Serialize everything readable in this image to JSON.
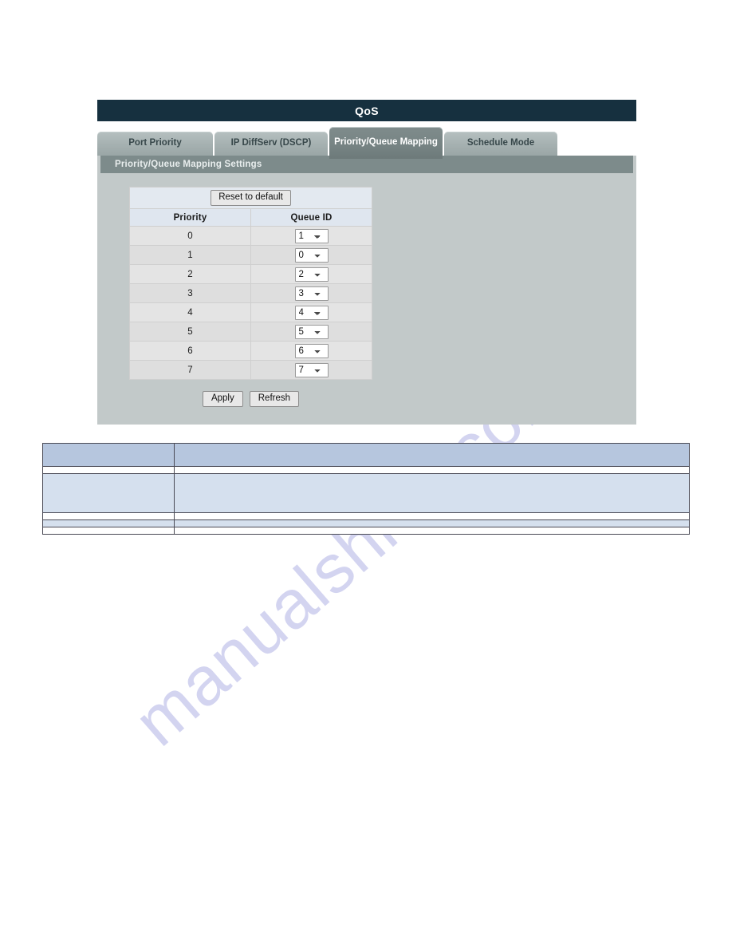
{
  "panel": {
    "title": "QoS",
    "tabs": [
      {
        "label": "Port Priority",
        "active": false
      },
      {
        "label": "IP DiffServ (DSCP)",
        "active": false
      },
      {
        "label": "Priority/Queue Mapping",
        "active": true
      },
      {
        "label": "Schedule Mode",
        "active": false
      }
    ],
    "section_header": "Priority/Queue Mapping Settings",
    "reset_button": "Reset to default",
    "table": {
      "headers": [
        "Priority",
        "Queue ID"
      ],
      "rows": [
        {
          "priority": "0",
          "queue_id": "1"
        },
        {
          "priority": "1",
          "queue_id": "0"
        },
        {
          "priority": "2",
          "queue_id": "2"
        },
        {
          "priority": "3",
          "queue_id": "3"
        },
        {
          "priority": "4",
          "queue_id": "4"
        },
        {
          "priority": "5",
          "queue_id": "5"
        },
        {
          "priority": "6",
          "queue_id": "6"
        },
        {
          "priority": "7",
          "queue_id": "7"
        }
      ],
      "queue_options": [
        "0",
        "1",
        "2",
        "3",
        "4",
        "5",
        "6",
        "7"
      ]
    },
    "apply_button": "Apply",
    "refresh_button": "Refresh"
  },
  "description_table": {
    "rows": [
      {
        "term": "",
        "description": "",
        "style": "head",
        "tall": false
      },
      {
        "term": "",
        "description": "",
        "style": "norm",
        "tall": false
      },
      {
        "term": "",
        "description": "",
        "style": "alt",
        "tall": true
      },
      {
        "term": "",
        "description": "",
        "style": "norm",
        "tall": false
      },
      {
        "term": "",
        "description": "",
        "style": "alt",
        "tall": false
      },
      {
        "term": "",
        "description": "",
        "style": "norm",
        "tall": false
      }
    ]
  },
  "watermark": {
    "text": "manualshive.com"
  },
  "colors": {
    "titlebar": "#16303f",
    "tab_inactive": "#a7b2b2",
    "tab_active": "#778484",
    "panel_body": "#c2c9c9",
    "section_header": "#7d8b8b",
    "desc_head": "#b6c6de",
    "desc_alt": "#d5e0ee",
    "watermark": "#b9bbe8"
  }
}
